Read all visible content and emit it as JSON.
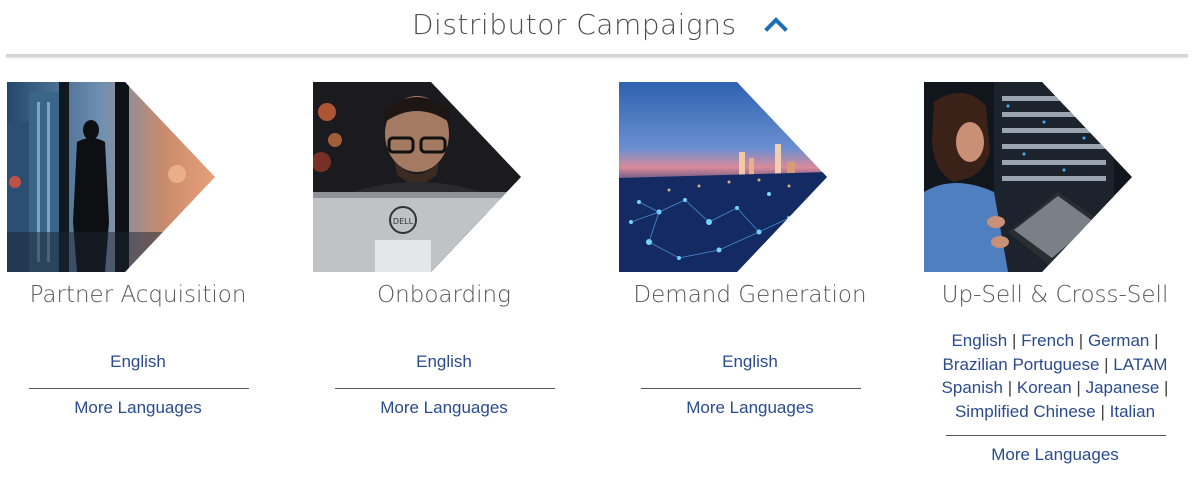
{
  "header": {
    "title": "Distributor Campaigns",
    "toggle_icon": "chevron-up-icon"
  },
  "cards": [
    {
      "title": "Partner Acquisition",
      "image": "city-skyline-silhouette-image",
      "language_link": "English",
      "more_link": "More Languages"
    },
    {
      "title": "Onboarding",
      "image": "man-at-computer-image",
      "language_link": "English",
      "more_link": "More Languages"
    },
    {
      "title": "Demand Generation",
      "image": "night-city-network-image",
      "language_link": "English",
      "more_link": "More Languages"
    },
    {
      "title": "Up-Sell & Cross-Sell",
      "image": "woman-with-laptop-server-image",
      "languages": [
        "English",
        "French",
        "German",
        "Brazilian Portuguese",
        "LATAM Spanish",
        "Korean",
        "Japanese",
        "Simplified Chinese",
        "Italian"
      ],
      "more_link": "More Languages"
    }
  ],
  "colors": {
    "link": "#2a4b8d",
    "title": "#555555",
    "accent": "#1f6fb5"
  }
}
